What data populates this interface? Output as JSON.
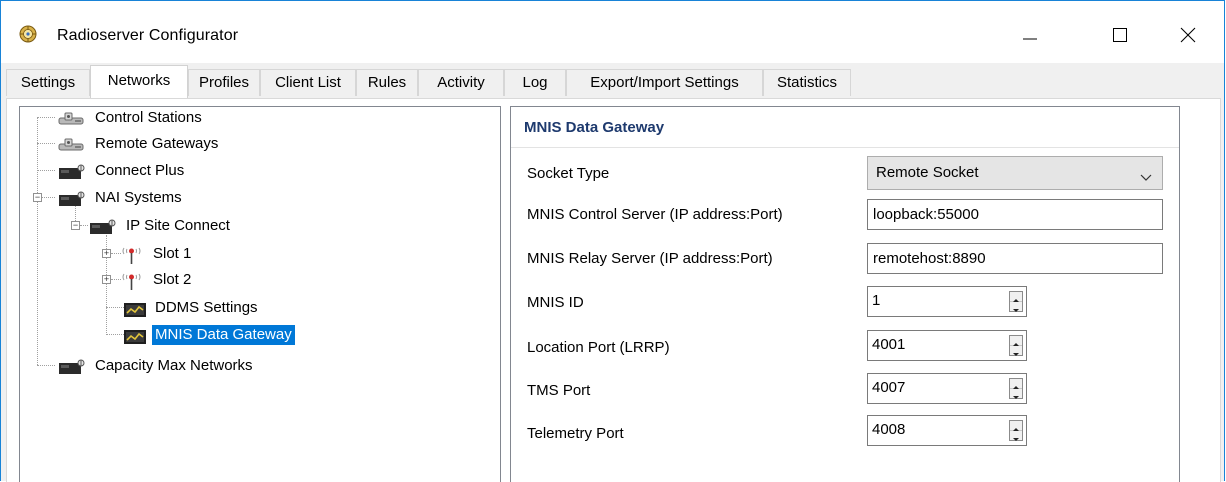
{
  "window": {
    "title": "Radioserver Configurator",
    "icon": "radioserver-app-icon"
  },
  "tabs": [
    {
      "label": "Settings"
    },
    {
      "label": "Networks",
      "active": true
    },
    {
      "label": "Profiles"
    },
    {
      "label": "Client List"
    },
    {
      "label": "Rules"
    },
    {
      "label": "Activity"
    },
    {
      "label": "Log"
    },
    {
      "label": "Export/Import Settings"
    },
    {
      "label": "Statistics"
    }
  ],
  "tree": {
    "nodes": [
      {
        "label": "Control Stations",
        "icon": "radio-stations-icon"
      },
      {
        "label": "Remote Gateways",
        "icon": "radio-stations-icon"
      },
      {
        "label": "Connect Plus",
        "icon": "network-device-icon"
      },
      {
        "label": "NAI Systems",
        "icon": "network-device-icon",
        "expanded": true
      },
      {
        "label": "IP Site Connect",
        "icon": "network-device-icon",
        "expanded": true
      },
      {
        "label": "Slot 1",
        "icon": "antenna-icon",
        "collapsed": true
      },
      {
        "label": "Slot 2",
        "icon": "antenna-icon",
        "collapsed": true
      },
      {
        "label": "DDMS Settings",
        "icon": "gateway-monitor-icon"
      },
      {
        "label": "MNIS Data Gateway",
        "icon": "gateway-monitor-icon",
        "selected": true
      },
      {
        "label": "Capacity Max Networks",
        "icon": "network-device-icon"
      }
    ]
  },
  "panel": {
    "title": "MNIS Data Gateway",
    "socket_type": {
      "label": "Socket Type",
      "value": "Remote Socket"
    },
    "control_server": {
      "label": "MNIS Control Server (IP address:Port)",
      "value": "loopback:55000"
    },
    "relay_server": {
      "label": "MNIS Relay Server (IP address:Port)",
      "value": "remotehost:8890"
    },
    "mnis_id": {
      "label": "MNIS ID",
      "value": "1"
    },
    "location_port": {
      "label": "Location Port (LRRP)",
      "value": "4001"
    },
    "tms_port": {
      "label": "TMS Port",
      "value": "4007"
    },
    "telemetry_port": {
      "label": "Telemetry Port",
      "value": "4008"
    }
  },
  "colors": {
    "accent": "#0078d7",
    "title_text": "#1e3a6e",
    "window_border": "#1883d7"
  }
}
